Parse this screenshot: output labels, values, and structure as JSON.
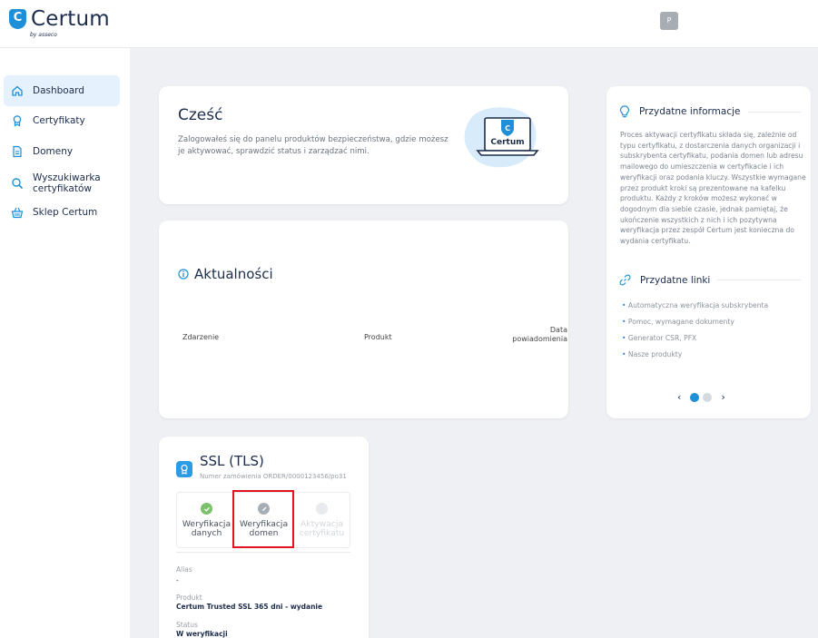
{
  "brand": {
    "name": "Certum",
    "sub": "by asseco",
    "shield_letter": "C",
    "accent": "#1f8fd8",
    "dark": "#1c2c4c"
  },
  "user": {
    "initial": "P"
  },
  "sidebar": {
    "items": [
      {
        "label": "Dashboard",
        "icon": "home-icon",
        "active": true
      },
      {
        "label": "Certyfikaty",
        "icon": "award-icon"
      },
      {
        "label": "Domeny",
        "icon": "document-icon"
      },
      {
        "label": "Wyszukiwarka",
        "label2": "certyfikatów",
        "icon": "search-icon"
      },
      {
        "label": "Sklep Certum",
        "icon": "basket-icon"
      }
    ]
  },
  "hello": {
    "title": "Cześć",
    "text": "Zalogowałeś się do panelu produktów bezpieczeństwa, gdzie możesz je aktywować, sprawdzić status i zarządzać nimi.",
    "illustration_label": "Certum"
  },
  "news": {
    "title": "Aktualności",
    "columns": {
      "event": "Zdarzenie",
      "product": "Produkt",
      "date_line1": "Data",
      "date_line2": "powiadomienia"
    }
  },
  "info": {
    "title": "Przydatne informacje",
    "text": "Proces aktywacji certyfikatu składa się, zależnie od typu certyfikatu, z dostarczenia danych organizacji i subskrybenta certyfikatu, podania domen lub adresu mailowego do umieszczenia w certyfikacie i ich weryfikacji oraz podania kluczy. Wszystkie wymagane przez produkt kroki są prezentowane na kafelku produktu. Każdy z kroków możesz wykonać w dogodnym dla siebie czasie, jednak pamiętaj, że ukończenie wszystkich z nich i ich pozytywna weryfikacja przez zespół Certum jest konieczna do wydania certyfikatu.",
    "links_title": "Przydatne linki",
    "links": [
      "Automatyczna weryfikacja subskrybenta",
      "Pomoc, wymagane dokumenty",
      "Generator CSR, PFX",
      "Nasze produkty"
    ],
    "carousel": {
      "prev": "‹",
      "next": "›",
      "active_index": 0,
      "count": 2
    }
  },
  "ssl": {
    "title": "SSL (TLS)",
    "order": "Numer zamówienia ORDER/0000123456/po31",
    "steps": [
      {
        "line1": "Weryfikacja",
        "line2": "danych",
        "state": "done"
      },
      {
        "line1": "Weryfikacja",
        "line2": "domen",
        "state": "in-progress"
      },
      {
        "line1": "Aktywacja",
        "line2": "certyfikatu",
        "state": "disabled"
      }
    ],
    "alias_label": "Alias",
    "alias_value": "-",
    "product_label": "Produkt",
    "product_value": "Certum Trusted SSL 365 dni - wydanie",
    "status_label": "Status",
    "status_value": "W weryfikacji"
  }
}
